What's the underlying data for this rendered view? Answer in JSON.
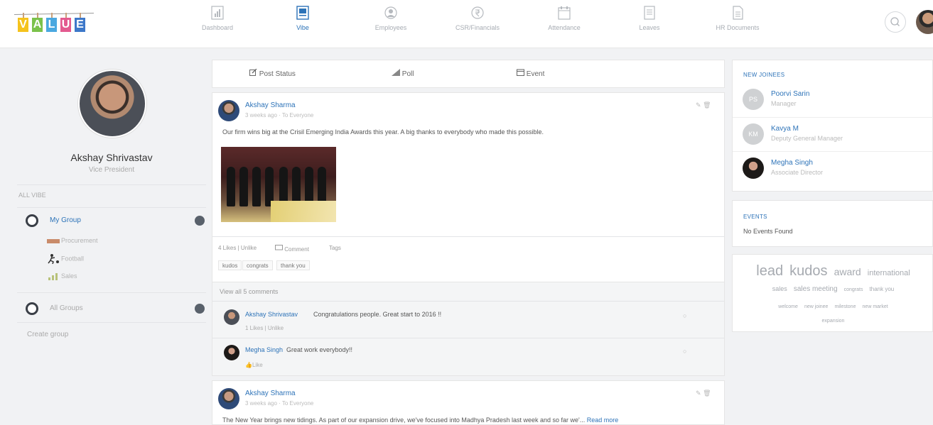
{
  "logo": {
    "letters": [
      "V",
      "A",
      "L",
      "U",
      "E"
    ],
    "tile_colors": [
      "#f5c31d",
      "#7bc24b",
      "#4aa8e0",
      "#e35a8f",
      "#3d78c9"
    ]
  },
  "nav": [
    {
      "label": "Dashboard",
      "icon": "bar-chart-icon",
      "active": false
    },
    {
      "label": "Vibe",
      "icon": "vibe-icon",
      "active": true
    },
    {
      "label": "Employees",
      "icon": "user-icon",
      "active": false
    },
    {
      "label": "CSR/Financials",
      "icon": "rupee-icon",
      "active": false
    },
    {
      "label": "Attendance",
      "icon": "calendar-icon",
      "active": false
    },
    {
      "label": "Leaves",
      "icon": "document-icon",
      "active": false
    },
    {
      "label": "HR Documents",
      "icon": "file-icon",
      "active": false
    }
  ],
  "accent_color": "#2d73b8",
  "profile": {
    "name": "Akshay Shrivastav",
    "title": "Vice President"
  },
  "left": {
    "all_vibe": "ALL VIBE",
    "my_group": "My Group",
    "sub_groups": [
      "Procurement",
      "Football",
      "Sales"
    ],
    "all_groups": "All Groups",
    "create_group": "Create group"
  },
  "composer": {
    "post_status": "Post Status",
    "poll": "Poll",
    "event": "Event"
  },
  "posts": [
    {
      "author": "Akshay Sharma",
      "meta": "3 weeks ago · To Everyone",
      "text": "Our firm wins big at the Crisil Emerging India Awards this year. A big thanks to everybody who made this possible.",
      "stats": "4 Likes | Unlike",
      "comment_label": "Comment",
      "tags_label": "Tags",
      "tags": [
        "kudos",
        "congrats",
        "thank you"
      ],
      "view_all": "View all 5 comments",
      "comments": [
        {
          "author": "Akshay Shrivastav",
          "text": "Congratulations people. Great start to 2016 !!",
          "meta": "1 Likes | Unlike"
        },
        {
          "author": "Megha Singh",
          "text": "Great work everybody!!",
          "meta": "Like"
        }
      ]
    },
    {
      "author": "Akshay Sharma",
      "meta": "3 weeks ago · To Everyone",
      "text": "The New Year brings new tidings. As part of our expansion drive, we've focused into Madhya Pradesh last week and so far we'...",
      "read_more": "Read more"
    }
  ],
  "new_joinees": {
    "title": "NEW JOINEES",
    "items": [
      {
        "initials": "PS",
        "name": "Poorvi Sarin",
        "role": "Manager"
      },
      {
        "initials": "KM",
        "name": "Kavya M",
        "role": "Deputy General Manager"
      },
      {
        "initials": "",
        "name": "Megha Singh",
        "role": "Associate Director"
      }
    ]
  },
  "events": {
    "title": "EVENTS",
    "empty": "No Events Found"
  },
  "tag_cloud": {
    "row1": [
      "lead",
      "kudos",
      "award",
      "international"
    ],
    "row2": [
      "sales",
      "sales meeting",
      "congrats",
      "thank you"
    ],
    "row3": [
      "welcome",
      "new joinee",
      "milestone",
      "new market"
    ],
    "row4": [
      "expansion"
    ]
  }
}
